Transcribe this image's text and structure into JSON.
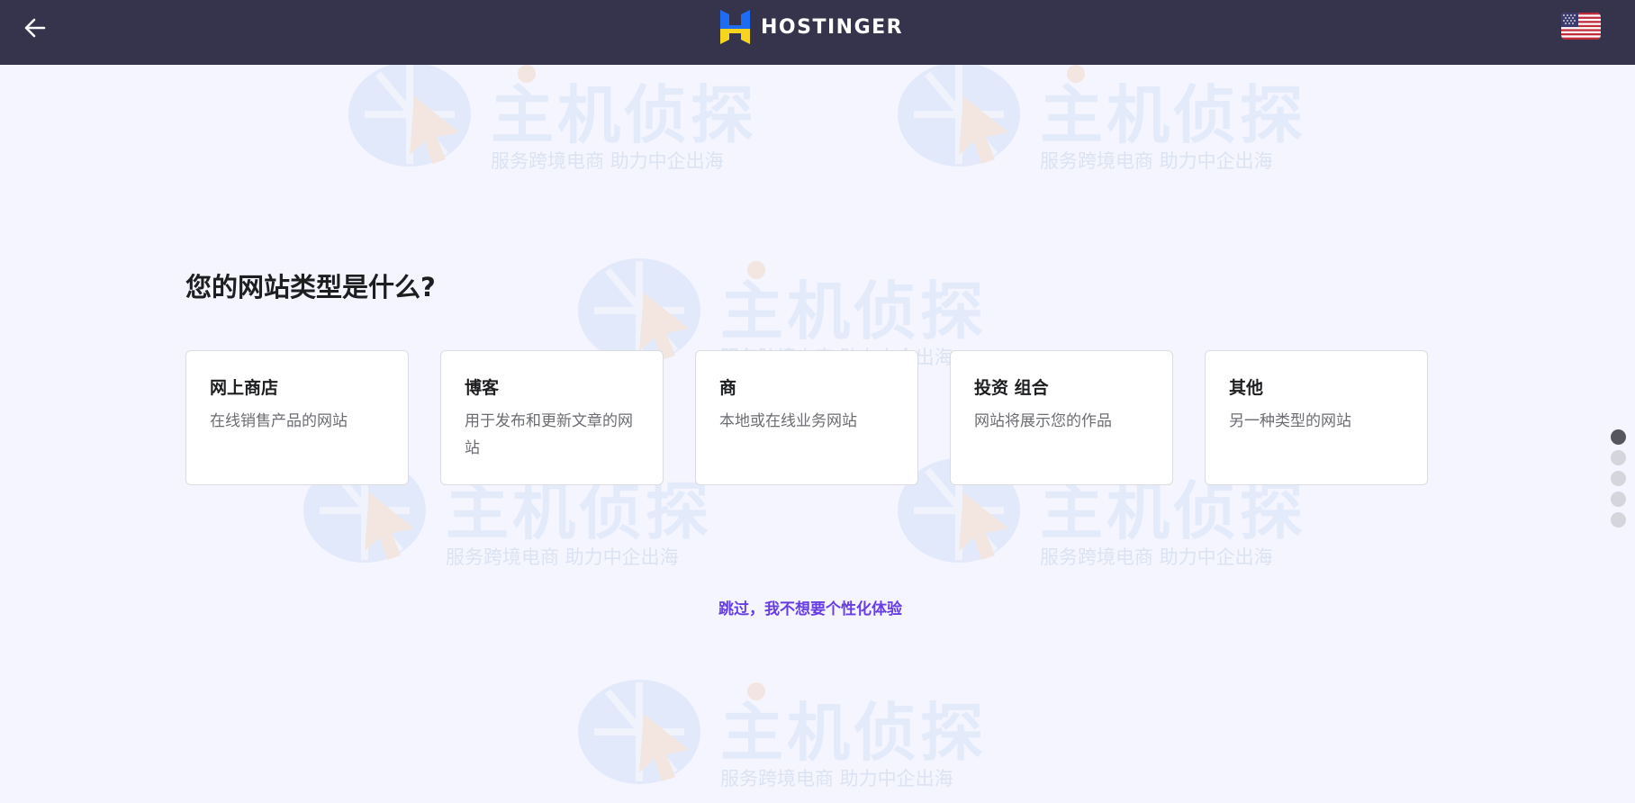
{
  "header": {
    "back_icon": "arrow-left-icon",
    "logo_text": "HOSTINGER",
    "logo_colors": {
      "blue": "#1e6cf2",
      "yellow": "#f7d51f"
    },
    "language_flag": "us-flag-icon"
  },
  "main": {
    "question": "您的网站类型是什么?",
    "options": [
      {
        "title": "网上商店",
        "description": "在线销售产品的网站"
      },
      {
        "title": "博客",
        "description": "用于发布和更新文章的网站"
      },
      {
        "title": "商",
        "description": "本地或在线业务网站"
      },
      {
        "title": "投资 组合",
        "description": "网站将展示您的作品"
      },
      {
        "title": "其他",
        "description": "另一种类型的网站"
      }
    ],
    "skip_link": "跳过，我不想要个性化体验"
  },
  "watermark": {
    "main_text": "主机侦探",
    "sub_text": "服务跨境电商 助力中企出海"
  },
  "progress": {
    "steps": 5,
    "current": 1
  },
  "colors": {
    "header_bg": "#36344d",
    "page_bg": "#f4f5ff",
    "accent": "#673de6"
  }
}
